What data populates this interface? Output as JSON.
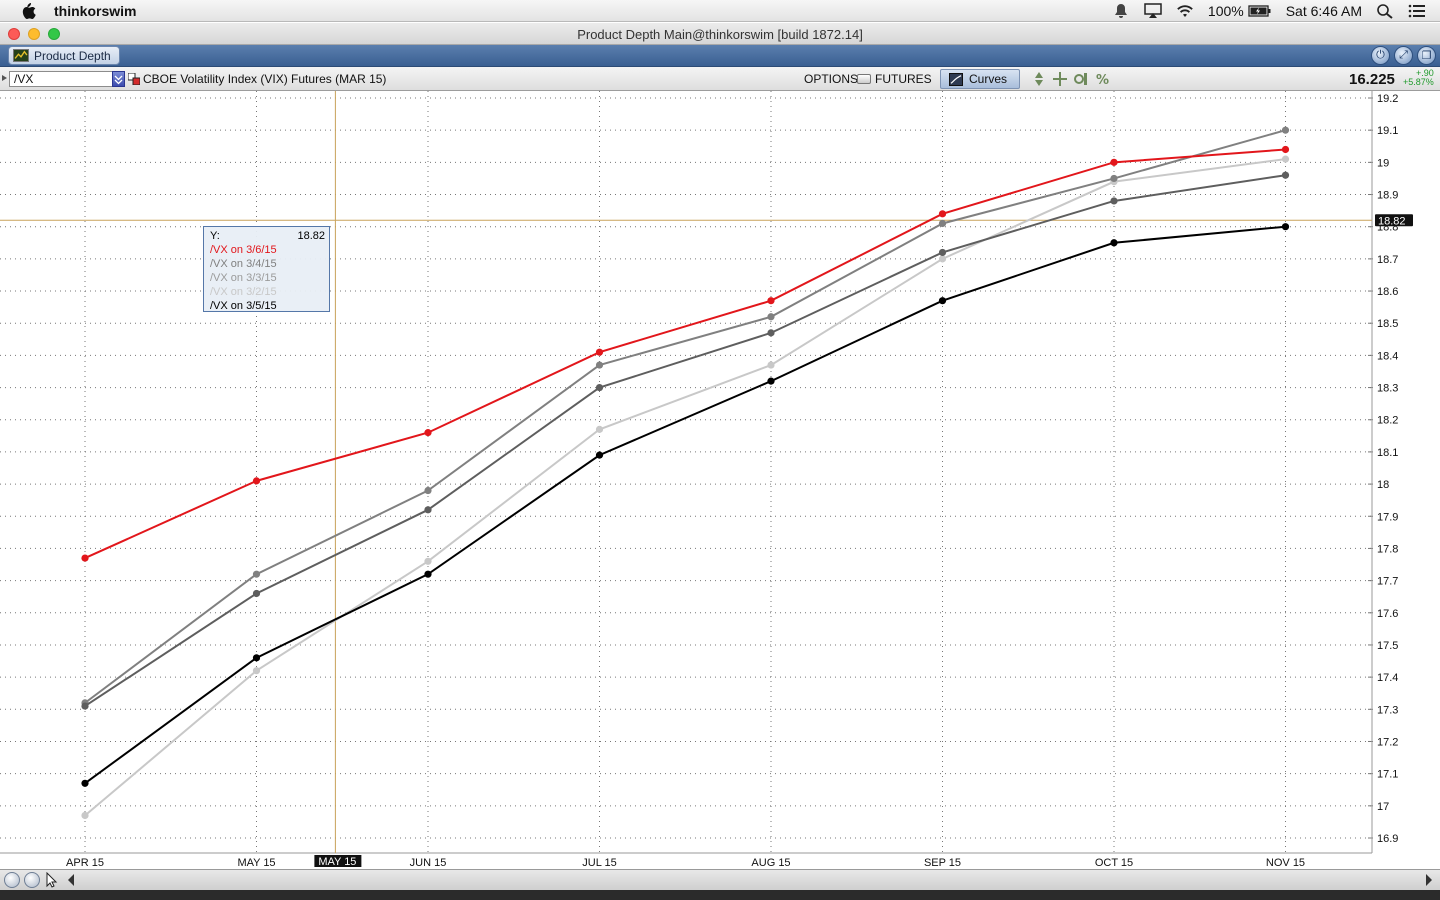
{
  "menubar": {
    "app_name": "thinkorswim",
    "battery": "100%",
    "clock": "Sat 6:46 AM",
    "icons": [
      "apple-icon",
      "notification-icon",
      "airplay-icon",
      "wifi-icon",
      "battery-icon",
      "spotlight-icon",
      "notification-center-icon"
    ]
  },
  "window": {
    "title": "Product Depth Main@thinkorswim [build 1872.14]"
  },
  "tabs": {
    "active_label": "Product Depth"
  },
  "toolbar": {
    "symbol": "/VX",
    "description": "CBOE Volatility Index (VIX) Futures (MAR 15)",
    "options_label": "OPTIONS",
    "futures_label": "FUTURES",
    "curves_label": "Curves",
    "last_price": "16.225",
    "change": "+.90",
    "change_pct": "+5.87%"
  },
  "crosshair": {
    "y_value": 18.82,
    "y_label": "18.82",
    "x_label": "MAY 15",
    "x_index": 1.46
  },
  "tooltip": {
    "y_label": "Y:",
    "y_value": "18.82",
    "entries": [
      {
        "label": "/VX on 3/6/15",
        "color": "#e2161b"
      },
      {
        "label": "/VX on 3/4/15",
        "color": "#808080"
      },
      {
        "label": "/VX on 3/3/15",
        "color": "#9b9b9b"
      },
      {
        "label": "/VX on 3/2/15",
        "color": "#c8c8c8"
      },
      {
        "label": "/VX on 3/5/15",
        "color": "#000000"
      }
    ]
  },
  "chart_data": {
    "type": "line",
    "categories": [
      "APR 15",
      "MAY 15",
      "JUN 15",
      "JUL 15",
      "AUG 15",
      "SEP 15",
      "OCT 15",
      "NOV 15"
    ],
    "ylim": [
      16.88,
      19.22
    ],
    "yticks": [
      16.9,
      17,
      17.1,
      17.2,
      17.3,
      17.4,
      17.5,
      17.6,
      17.7,
      17.8,
      17.9,
      18,
      18.1,
      18.2,
      18.3,
      18.4,
      18.5,
      18.6,
      18.7,
      18.8,
      18.9,
      19,
      19.1,
      19.2
    ],
    "ytick_labels": [
      "16.9",
      "17",
      "17.1",
      "17.2",
      "17.3",
      "17.4",
      "17.5",
      "17.6",
      "17.7",
      "17.8",
      "17.9",
      "18",
      "18.1",
      "18.2",
      "18.3",
      "18.4",
      "18.5",
      "18.6",
      "18.7",
      "18.8",
      "18.9",
      "19",
      "19.1",
      "19.2"
    ],
    "grid": true,
    "series": [
      {
        "name": "/VX on 3/2/15",
        "color": "#c8c8c8",
        "values": [
          16.97,
          17.42,
          17.76,
          18.17,
          18.37,
          18.7,
          18.94,
          19.01
        ]
      },
      {
        "name": "/VX on 3/4/15",
        "color": "#808080",
        "values": [
          17.32,
          17.72,
          17.98,
          18.37,
          18.52,
          18.81,
          18.95,
          19.1
        ]
      },
      {
        "name": "/VX on 3/3/15",
        "color": "#5e5e5e",
        "values": [
          17.31,
          17.66,
          17.92,
          18.3,
          18.47,
          18.72,
          18.88,
          18.96
        ]
      },
      {
        "name": "/VX on 3/5/15",
        "color": "#000000",
        "values": [
          17.07,
          17.46,
          17.72,
          18.09,
          18.32,
          18.57,
          18.75,
          18.8
        ]
      },
      {
        "name": "/VX on 3/6/15",
        "color": "#e2161b",
        "values": [
          17.77,
          18.01,
          18.16,
          18.41,
          18.57,
          18.84,
          19.0,
          19.04
        ]
      }
    ]
  }
}
